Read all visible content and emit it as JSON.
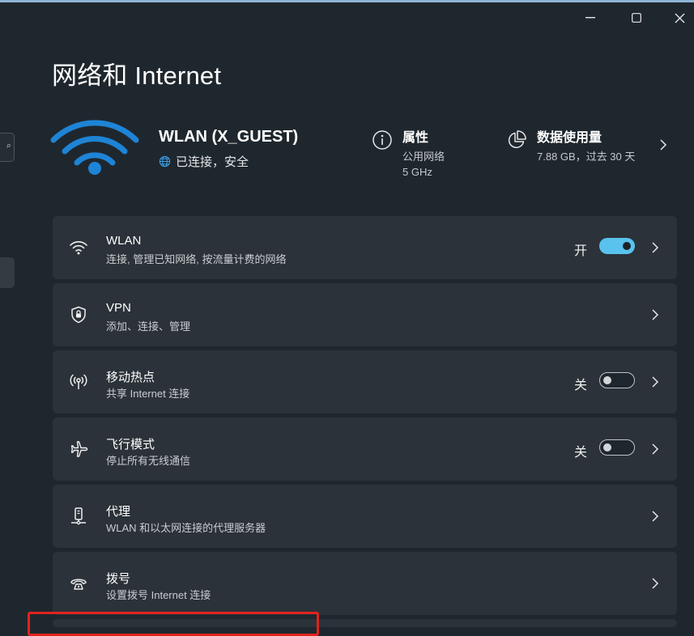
{
  "window": {
    "title": "网络和 Internet",
    "controls": {
      "minimize": "—",
      "maximize": "☐",
      "close": "✕"
    }
  },
  "header": {
    "network_name": "WLAN (X_GUEST)",
    "network_status": "已连接，安全",
    "properties": {
      "title": "属性",
      "line1": "公用网络",
      "line2": "5 GHz"
    },
    "data_usage": {
      "title": "数据使用量",
      "detail": "7.88 GB，过去 30 天"
    }
  },
  "rows": [
    {
      "icon": "wifi-icon",
      "title": "WLAN",
      "subtitle": "连接, 管理已知网络, 按流量计费的网络",
      "state": "开",
      "toggle": true
    },
    {
      "icon": "vpn-shield-icon",
      "title": "VPN",
      "subtitle": "添加、连接、管理"
    },
    {
      "icon": "hotspot-icon",
      "title": "移动热点",
      "subtitle": "共享 Internet 连接",
      "state": "关",
      "toggle": false
    },
    {
      "icon": "airplane-icon",
      "title": "飞行模式",
      "subtitle": "停止所有无线通信",
      "state": "关",
      "toggle": false
    },
    {
      "icon": "proxy-icon",
      "title": "代理",
      "subtitle": "WLAN 和以太网连接的代理服务器"
    },
    {
      "icon": "dialup-icon",
      "title": "拨号",
      "subtitle": "设置拨号 Internet 连接"
    }
  ],
  "colors": {
    "background": "#1f272e",
    "card": "#2b3239",
    "accent": "#5ac2ee",
    "wifi_blue": "#1e84d6",
    "highlight_box": "#e0231e"
  }
}
